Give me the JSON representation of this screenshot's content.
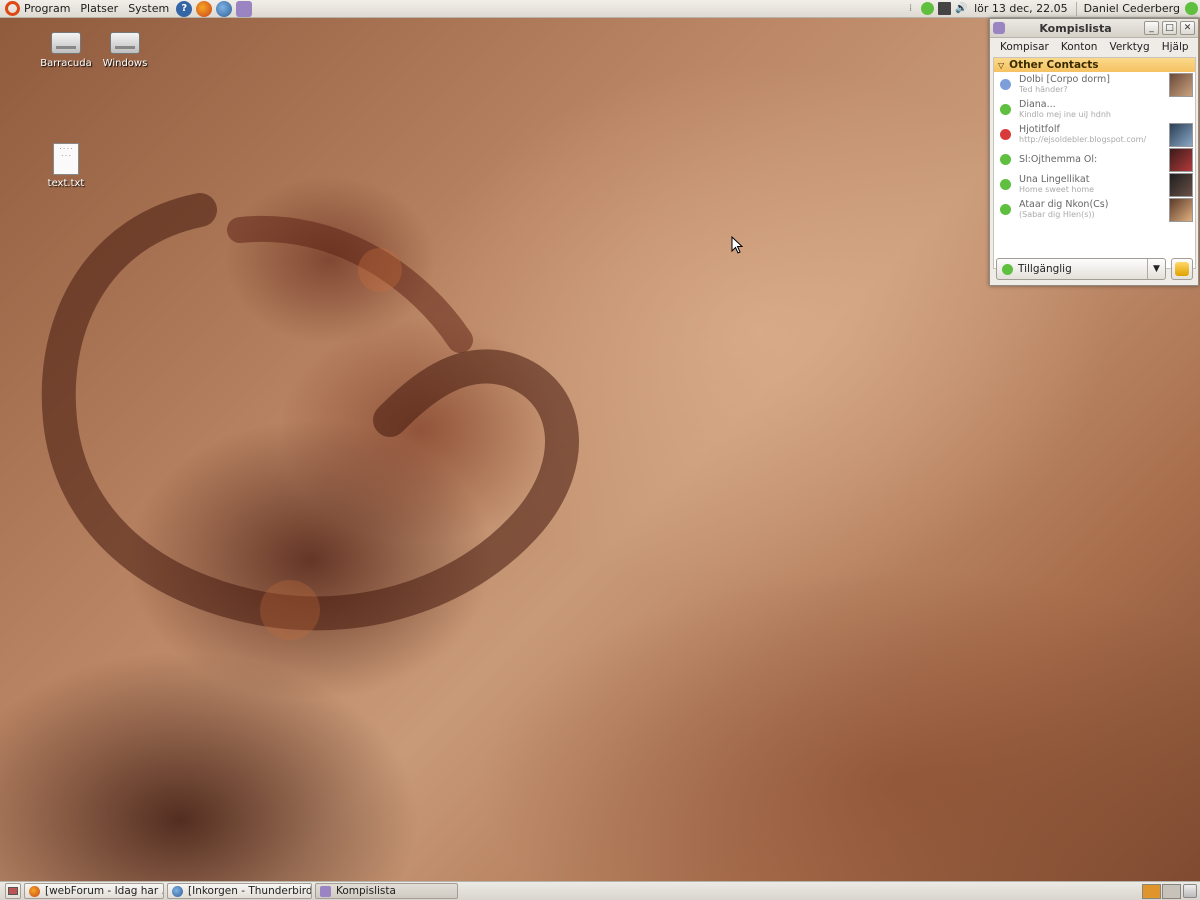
{
  "top_panel": {
    "menus": [
      "Program",
      "Platser",
      "System"
    ],
    "clock": "lör 13 dec, 22.05",
    "user": "Daniel Cederberg"
  },
  "desktop": {
    "icons": [
      {
        "label": "Barracuda",
        "type": "drive"
      },
      {
        "label": "Windows",
        "type": "drive"
      },
      {
        "label": "text.txt",
        "type": "text-file"
      }
    ]
  },
  "buddy_list": {
    "title": "Kompislista",
    "menu": [
      "Kompisar",
      "Konton",
      "Verktyg",
      "Hjälp"
    ],
    "group": "Other Contacts",
    "contacts": [
      {
        "name": "Dolbi [Corpo dorm]",
        "message": "Ted händer?",
        "status": "away",
        "status_color": "#7d9ed8"
      },
      {
        "name": "Diana...",
        "message": "Kindlo mej ine uiJ hdnh",
        "status": "available",
        "status_color": "#5fbf3f"
      },
      {
        "name": "Hjotitfolf",
        "message": "http://ejsoldebler.blogspot.com/",
        "status": "busy",
        "status_color": "#d93b3b"
      },
      {
        "name": "Sl:Ojthemma Ol:",
        "message": "",
        "status": "available",
        "status_color": "#5fbf3f"
      },
      {
        "name": "Una Lingellikat",
        "message": "Home sweet home",
        "status": "available",
        "status_color": "#5fbf3f"
      },
      {
        "name": "Ataar dig Nkon(Cs)",
        "message": "(Sabar dig Hlen(s))",
        "status": "available",
        "status_color": "#5fbf3f"
      }
    ],
    "status_selector": "Tillgänglig"
  },
  "taskbar": {
    "tasks": [
      {
        "label": "[webForum - Idag har ...",
        "icon": "firefox-icon"
      },
      {
        "label": "[Inkorgen - Thunderbird]",
        "icon": "thunderbird-icon"
      },
      {
        "label": "Kompislista",
        "icon": "pidgin-icon"
      }
    ]
  },
  "colors": {
    "group_header": "#f5c261",
    "available": "#5fbf3f",
    "busy": "#d93b3b",
    "away": "#7d9ed8",
    "ubuntu_orange": "#dd4814"
  }
}
